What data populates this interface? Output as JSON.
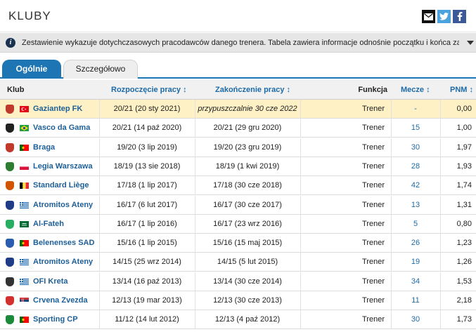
{
  "header": {
    "title": "KLUBY"
  },
  "info": {
    "text": "Zestawienie wykazuje dotychczasowych pracodawców danego trenera. Tabela zawiera informacje odnośnie początku i końca zatrudnienia, pełni..."
  },
  "tabs": [
    {
      "label": "Ogólnie",
      "active": true
    },
    {
      "label": "Szczegółowo",
      "active": false
    }
  ],
  "table": {
    "headers": {
      "club": "Klub",
      "start": "Rozpoczęcie pracy",
      "end": "Zakończenie pracy",
      "function": "Funkcja",
      "games": "Mecze",
      "ppm": "PNM"
    },
    "rows": [
      {
        "club": "Gaziantep FK",
        "start": "20/21 (20 sty 2021)",
        "end": "przypuszczalnie 30 cze 2022",
        "function": "Trener",
        "games": "-",
        "ppm": "0,00",
        "highlight": true,
        "crest": "#c0392b",
        "flag": "turkey"
      },
      {
        "club": "Vasco da Gama",
        "start": "20/21 (14 paź 2020)",
        "end": "20/21 (29 gru 2020)",
        "function": "Trener",
        "games": "15",
        "ppm": "1,00",
        "crest": "#222222",
        "flag": "brazil"
      },
      {
        "club": "Braga",
        "start": "19/20 (3 lip 2019)",
        "end": "19/20 (23 gru 2019)",
        "function": "Trener",
        "games": "30",
        "ppm": "1,97",
        "crest": "#c0392b",
        "flag": "portugal"
      },
      {
        "club": "Legia Warszawa",
        "start": "18/19 (13 sie 2018)",
        "end": "18/19 (1 kwi 2019)",
        "function": "Trener",
        "games": "28",
        "ppm": "1,93",
        "crest": "#2e7d32",
        "flag": "poland"
      },
      {
        "club": "Standard Liège",
        "start": "17/18 (1 lip 2017)",
        "end": "17/18 (30 cze 2018)",
        "function": "Trener",
        "games": "42",
        "ppm": "1,74",
        "crest": "#d35400",
        "flag": "belgium"
      },
      {
        "club": "Atromitos Ateny",
        "start": "16/17 (6 lut 2017)",
        "end": "16/17 (30 cze 2017)",
        "function": "Trener",
        "games": "13",
        "ppm": "1,31",
        "crest": "#1f3c88",
        "flag": "greece"
      },
      {
        "club": "Al-Fateh",
        "start": "16/17 (1 lip 2016)",
        "end": "16/17 (23 wrz 2016)",
        "function": "Trener",
        "games": "5",
        "ppm": "0,80",
        "crest": "#27ae60",
        "flag": "saudi"
      },
      {
        "club": "Belenenses SAD",
        "start": "15/16 (1 lip 2015)",
        "end": "15/16 (15 maj 2015)",
        "function": "Trener",
        "games": "26",
        "ppm": "1,23",
        "crest": "#2a5db0",
        "flag": "portugal"
      },
      {
        "club": "Atromitos Ateny",
        "start": "14/15 (25 wrz 2014)",
        "end": "14/15 (5 lut 2015)",
        "function": "Trener",
        "games": "19",
        "ppm": "1,26",
        "crest": "#1f3c88",
        "flag": "greece"
      },
      {
        "club": "OFI Kreta",
        "start": "13/14 (16 paź 2013)",
        "end": "13/14 (30 cze 2014)",
        "function": "Trener",
        "games": "34",
        "ppm": "1,53",
        "crest": "#333333",
        "flag": "greece"
      },
      {
        "club": "Crvena Zvezda",
        "start": "12/13 (19 mar 2013)",
        "end": "12/13 (30 cze 2013)",
        "function": "Trener",
        "games": "11",
        "ppm": "2,18",
        "crest": "#d32f2f",
        "flag": "serbia"
      },
      {
        "club": "Sporting CP",
        "start": "11/12 (14 lut 2012)",
        "end": "12/13 (4 paź 2012)",
        "function": "Trener",
        "games": "30",
        "ppm": "1,73",
        "crest": "#1b8a3a",
        "flag": "portugal"
      }
    ]
  }
}
